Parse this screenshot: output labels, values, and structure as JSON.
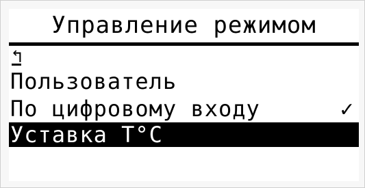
{
  "screen": {
    "title": "Управление режимом",
    "back_icon": "↰",
    "items": [
      {
        "label": "Пользователь",
        "checked": ""
      },
      {
        "label": "По цифровому входу",
        "checked": "✓"
      },
      {
        "label": "Уставка Т°С",
        "checked": ""
      }
    ]
  }
}
